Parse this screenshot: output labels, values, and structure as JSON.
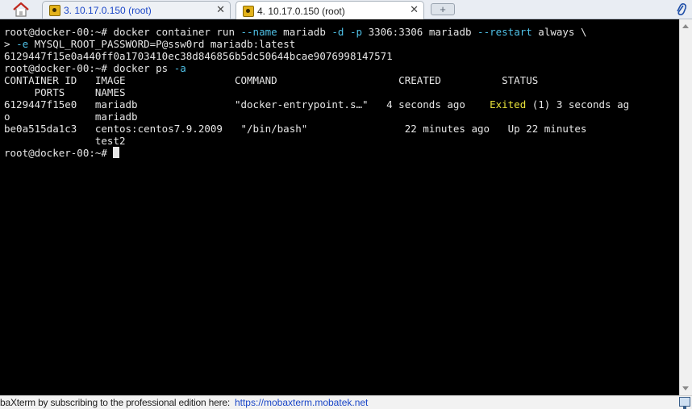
{
  "tabs": [
    {
      "label": "3. 10.17.0.150 (root)",
      "active": false
    },
    {
      "label": "4. 10.17.0.150 (root)",
      "active": true
    }
  ],
  "new_tab_symbol": "+",
  "terminal": {
    "lines": [
      [
        {
          "t": "root@docker-00:~# docker container run "
        },
        {
          "t": "--name",
          "c": "cyan"
        },
        {
          "t": " mariadb "
        },
        {
          "t": "-d",
          "c": "cyan"
        },
        {
          "t": " "
        },
        {
          "t": "-p",
          "c": "cyan"
        },
        {
          "t": " 3306:3306 mariadb "
        },
        {
          "t": "--restart",
          "c": "cyan"
        },
        {
          "t": " always \\"
        }
      ],
      [
        {
          "t": "> "
        },
        {
          "t": "-e",
          "c": "cyan"
        },
        {
          "t": " MYSQL_ROOT_PASSWORD=P@ssw0rd mariadb:latest"
        }
      ],
      [
        {
          "t": "6129447f15e0a440ff0a1703410ec38d846856b5dc50644bcae9076998147571"
        }
      ],
      [
        {
          "t": "root@docker-00:~# docker ps "
        },
        {
          "t": "-a",
          "c": "cyan"
        }
      ],
      [
        {
          "t": "CONTAINER ID   IMAGE                  COMMAND                    CREATED          STATUS"
        }
      ],
      [
        {
          "t": "     PORTS     NAMES"
        }
      ],
      [
        {
          "t": "6129447f15e0   mariadb                \"docker-entrypoint.s…\"   4 seconds ago    "
        },
        {
          "t": "Exited",
          "c": "yellow"
        },
        {
          "t": " (1) 3 seconds ag"
        }
      ],
      [
        {
          "t": "o              mariadb"
        }
      ],
      [
        {
          "t": "be0a515da1c3   centos:centos7.9.2009   \"/bin/bash\"                22 minutes ago   Up 22 minutes"
        }
      ],
      [
        {
          "t": "               test2"
        }
      ],
      [
        {
          "t": "root@docker-00:~# "
        },
        {
          "t": "",
          "cursor": true
        }
      ]
    ]
  },
  "statusbar": {
    "text": "baXterm by subscribing to the professional edition here:",
    "link": "https://mobaxterm.mobatek.net"
  },
  "colors": {
    "terminal_bg": "#000000",
    "terminal_fg": "#e6e6e6",
    "option_cyan": "#4fc0e6",
    "status_yellow": "#e8e23a",
    "link_blue": "#1a46c8"
  }
}
